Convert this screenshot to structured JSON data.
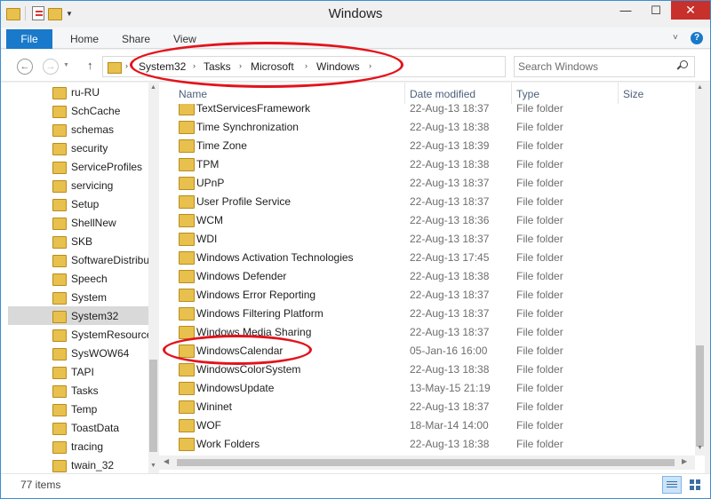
{
  "window": {
    "title": "Windows",
    "minimize": "—",
    "maximize": "☐",
    "close": "✕"
  },
  "ribbon": {
    "tabs": [
      "File",
      "Home",
      "Share",
      "View"
    ],
    "collapse": "˅",
    "help": "?"
  },
  "nav": {
    "back": "←",
    "forward": "→",
    "recent": "▼",
    "up": "↑",
    "breadcrumb": [
      "System32",
      "Tasks",
      "Microsoft",
      "Windows"
    ],
    "separator": "›",
    "dropdown": "▼",
    "refresh": "↻",
    "search_placeholder": "Search Windows"
  },
  "sidebar": {
    "items": [
      {
        "label": "ru-RU"
      },
      {
        "label": "SchCache"
      },
      {
        "label": "schemas"
      },
      {
        "label": "security"
      },
      {
        "label": "ServiceProfiles"
      },
      {
        "label": "servicing"
      },
      {
        "label": "Setup"
      },
      {
        "label": "ShellNew"
      },
      {
        "label": "SKB"
      },
      {
        "label": "SoftwareDistribution"
      },
      {
        "label": "Speech"
      },
      {
        "label": "System"
      },
      {
        "label": "System32",
        "selected": true
      },
      {
        "label": "SystemResources"
      },
      {
        "label": "SysWOW64"
      },
      {
        "label": "TAPI"
      },
      {
        "label": "Tasks"
      },
      {
        "label": "Temp"
      },
      {
        "label": "ToastData"
      },
      {
        "label": "tracing"
      },
      {
        "label": "twain_32"
      }
    ]
  },
  "columns": {
    "name": "Name",
    "date": "Date modified",
    "type": "Type",
    "size": "Size"
  },
  "files": [
    {
      "name": "TextServicesFramework",
      "date": "22-Aug-13 18:37",
      "type": "File folder"
    },
    {
      "name": "Time Synchronization",
      "date": "22-Aug-13 18:38",
      "type": "File folder"
    },
    {
      "name": "Time Zone",
      "date": "22-Aug-13 18:39",
      "type": "File folder"
    },
    {
      "name": "TPM",
      "date": "22-Aug-13 18:38",
      "type": "File folder"
    },
    {
      "name": "UPnP",
      "date": "22-Aug-13 18:37",
      "type": "File folder"
    },
    {
      "name": "User Profile Service",
      "date": "22-Aug-13 18:37",
      "type": "File folder"
    },
    {
      "name": "WCM",
      "date": "22-Aug-13 18:36",
      "type": "File folder"
    },
    {
      "name": "WDI",
      "date": "22-Aug-13 18:37",
      "type": "File folder"
    },
    {
      "name": "Windows Activation Technologies",
      "date": "22-Aug-13 17:45",
      "type": "File folder"
    },
    {
      "name": "Windows Defender",
      "date": "22-Aug-13 18:38",
      "type": "File folder"
    },
    {
      "name": "Windows Error Reporting",
      "date": "22-Aug-13 18:37",
      "type": "File folder"
    },
    {
      "name": "Windows Filtering Platform",
      "date": "22-Aug-13 18:37",
      "type": "File folder"
    },
    {
      "name": "Windows Media Sharing",
      "date": "22-Aug-13 18:37",
      "type": "File folder"
    },
    {
      "name": "WindowsCalendar",
      "date": "05-Jan-16 16:00",
      "type": "File folder"
    },
    {
      "name": "WindowsColorSystem",
      "date": "22-Aug-13 18:38",
      "type": "File folder"
    },
    {
      "name": "WindowsUpdate",
      "date": "13-May-15 21:19",
      "type": "File folder"
    },
    {
      "name": "Wininet",
      "date": "22-Aug-13 18:37",
      "type": "File folder"
    },
    {
      "name": "WOF",
      "date": "18-Mar-14 14:00",
      "type": "File folder"
    },
    {
      "name": "Work Folders",
      "date": "22-Aug-13 18:38",
      "type": "File folder"
    }
  ],
  "status": {
    "item_count": "77 items"
  },
  "colors": {
    "accent": "#1979ca",
    "annotation": "#e3131b",
    "folder": "#e8c04e"
  }
}
